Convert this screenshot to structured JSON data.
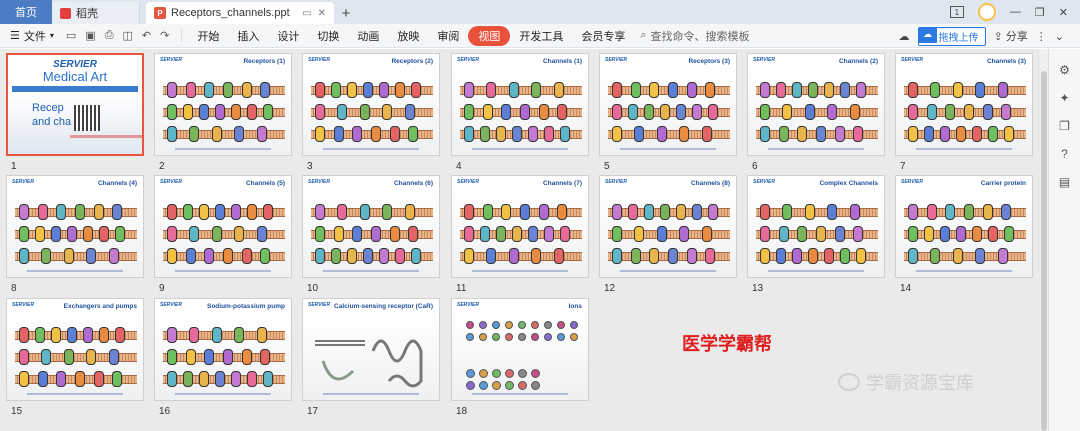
{
  "titlebar": {
    "home_tab": "首页",
    "tabs": [
      {
        "label": "稻壳"
      },
      {
        "label": "Receptors_channels.ppt"
      }
    ]
  },
  "menubar": {
    "file": "文件",
    "items": [
      "开始",
      "插入",
      "设计",
      "切换",
      "动画",
      "放映",
      "审阅",
      "视图",
      "开发工具",
      "会员专享"
    ],
    "selected": "视图",
    "search_placeholder": "查找命令、搜索模板",
    "upload_label": "拖拽上传",
    "share_label": "分享"
  },
  "slides": [
    {
      "num": "1",
      "title": ""
    },
    {
      "num": "2",
      "title": "Receptors (1)"
    },
    {
      "num": "3",
      "title": "Receptors (2)"
    },
    {
      "num": "4",
      "title": "Channels (1)"
    },
    {
      "num": "5",
      "title": "Receptors (3)"
    },
    {
      "num": "6",
      "title": "Channels (2)"
    },
    {
      "num": "7",
      "title": "Channels (3)"
    },
    {
      "num": "8",
      "title": "Channels (4)"
    },
    {
      "num": "9",
      "title": "Channels (5)"
    },
    {
      "num": "10",
      "title": "Channels (6)"
    },
    {
      "num": "11",
      "title": "Channels (7)"
    },
    {
      "num": "12",
      "title": "Channels (8)"
    },
    {
      "num": "13",
      "title": "Complex Channels"
    },
    {
      "num": "14",
      "title": "Carrier protein"
    },
    {
      "num": "15",
      "title": "Exchangers and pumps"
    },
    {
      "num": "16",
      "title": "Sodium-potassium pump"
    },
    {
      "num": "17",
      "title": "Calcium-sensing receptor (CaR)"
    },
    {
      "num": "18",
      "title": "Ions"
    }
  ],
  "cover": {
    "brand_top": "SERVIER",
    "brand_bottom": "Medical Art",
    "title_line1": "Recep",
    "title_line2": "and cha"
  },
  "watermarks": {
    "red": "医学学霸帮",
    "gray": "学霸资源宝库"
  },
  "colors": {
    "accent": "#e8523b",
    "home_tab": "#4b7cc4",
    "brand_blue": "#1f5fae"
  }
}
